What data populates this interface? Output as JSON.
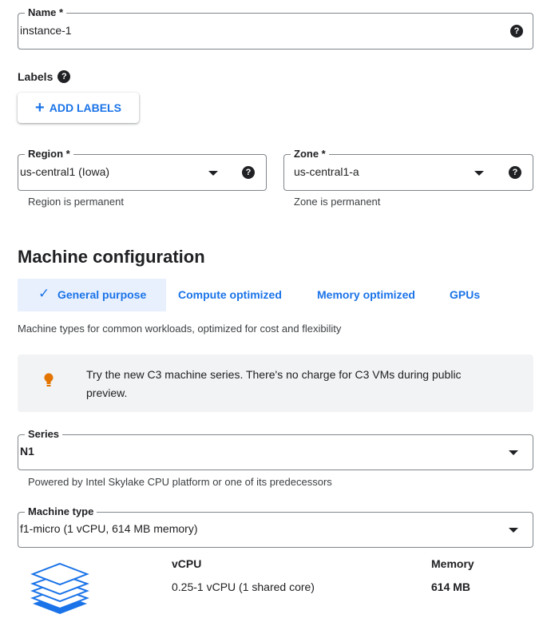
{
  "name_field": {
    "label": "Name *",
    "value": "instance-1"
  },
  "labels": {
    "title": "Labels",
    "add_button": "ADD LABELS"
  },
  "region": {
    "label": "Region *",
    "value": "us-central1 (Iowa)",
    "hint": "Region is permanent"
  },
  "zone": {
    "label": "Zone *",
    "value": "us-central1-a",
    "hint": "Zone is permanent"
  },
  "machine_config": {
    "title": "Machine configuration",
    "tabs": [
      {
        "label": "General purpose",
        "selected": true
      },
      {
        "label": "Compute optimized"
      },
      {
        "label": "Memory optimized"
      },
      {
        "label": "GPUs"
      }
    ],
    "description": "Machine types for common workloads, optimized for cost and flexibility",
    "banner": "Try the new C3 machine series. There's no charge for C3 VMs during public preview."
  },
  "series": {
    "label": "Series",
    "value": "N1",
    "hint": "Powered by Intel Skylake CPU platform or one of its predecessors"
  },
  "machine_type": {
    "label": "Machine type",
    "value": "f1-micro (1 vCPU, 614 MB memory)"
  },
  "specs": {
    "vcpu_header": "vCPU",
    "vcpu_value": "0.25-1 vCPU (1 shared core)",
    "memory_header": "Memory",
    "memory_value": "614 MB"
  },
  "icons": {
    "help": "help-icon",
    "dropdown": "chevron-down-icon",
    "add": "plus-icon",
    "check": "check-icon",
    "bulb": "lightbulb-icon",
    "stack": "layers-icon"
  },
  "colors": {
    "accent": "#1a73e8",
    "tab_selected_bg": "#e8f0fe",
    "banner_bg": "#f1f3f4",
    "bulb": "#e37400"
  }
}
